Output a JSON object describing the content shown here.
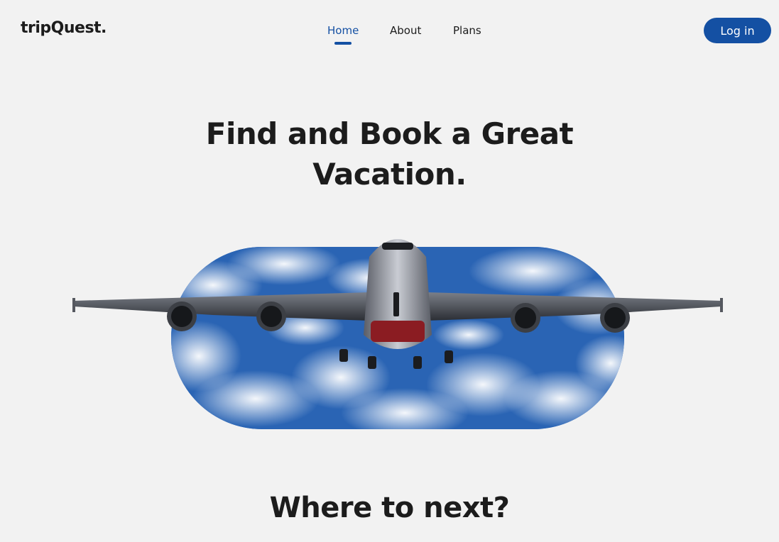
{
  "brand": {
    "name": "tripQuest."
  },
  "nav": {
    "items": [
      {
        "label": "Home",
        "active": true
      },
      {
        "label": "About",
        "active": false
      },
      {
        "label": "Plans",
        "active": false
      }
    ],
    "login_label": "Log in"
  },
  "hero": {
    "title_line1": "Find and Book a Great",
    "title_line2": "Vacation.",
    "image": "airplane-flying-in-cloudy-sky"
  },
  "section": {
    "title": "Where to next?"
  },
  "colors": {
    "accent": "#1450a3",
    "background": "#f2f2f2",
    "text": "#1c1c1c",
    "sky": "#2f6fc0"
  }
}
